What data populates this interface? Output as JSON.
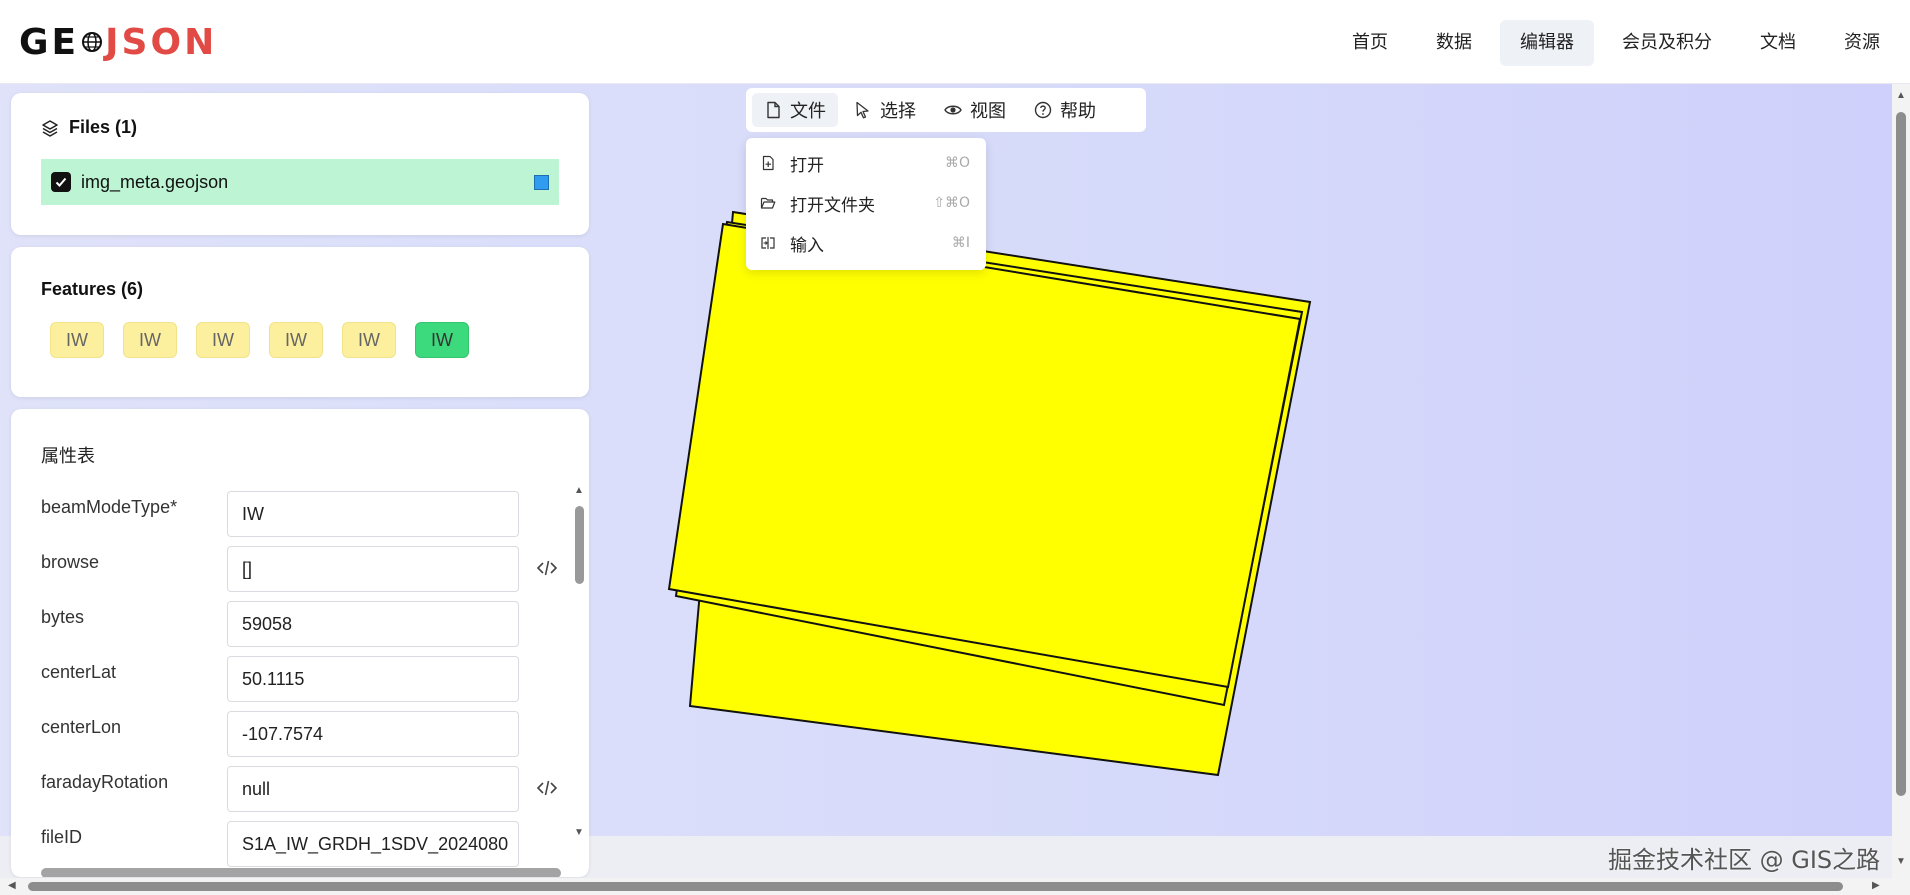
{
  "header": {
    "logo": {
      "part1": "GE",
      "part2": "JSON"
    },
    "nav": [
      "首页",
      "数据",
      "编辑器",
      "会员及积分",
      "文档",
      "资源"
    ],
    "active_nav": "编辑器"
  },
  "toolbar": {
    "file": "文件",
    "select": "选择",
    "view": "视图",
    "help": "帮助"
  },
  "file_menu": [
    {
      "label": "打开",
      "shortcut": "⌘O",
      "icon": "file-plus-icon"
    },
    {
      "label": "打开文件夹",
      "shortcut": "⇧⌘O",
      "icon": "folder-open-icon"
    },
    {
      "label": "输入",
      "shortcut": "⌘I",
      "icon": "import-icon"
    }
  ],
  "files_panel": {
    "title": "Files (1)",
    "files": [
      {
        "name": "img_meta.geojson",
        "checked": true,
        "color": "#2f9cf0"
      }
    ]
  },
  "features_panel": {
    "title": "Features (6)",
    "features": [
      "IW",
      "IW",
      "IW",
      "IW",
      "IW",
      "IW"
    ],
    "selected_index": 5
  },
  "properties_panel": {
    "title": "属性表",
    "rows": [
      {
        "key": "beamModeType*",
        "value": "IW",
        "code": false
      },
      {
        "key": "browse",
        "value": "[]",
        "code": true
      },
      {
        "key": "bytes",
        "value": "59058",
        "code": false
      },
      {
        "key": "centerLat",
        "value": "50.1115",
        "code": false
      },
      {
        "key": "centerLon",
        "value": "-107.7574",
        "code": false
      },
      {
        "key": "faradayRotation",
        "value": "null",
        "code": true
      },
      {
        "key": "fileID",
        "value": "S1A_IW_GRDH_1SDV_2024080",
        "code": false
      }
    ]
  },
  "colors": {
    "polygon_fill": "#ffff00",
    "feature_chip": "#fcef9e",
    "feature_chip_active": "#3dd97d",
    "file_row": "#bdf4d4",
    "logo_accent": "#e24b45"
  },
  "watermark": "掘金技术社区 @ GIS之路"
}
